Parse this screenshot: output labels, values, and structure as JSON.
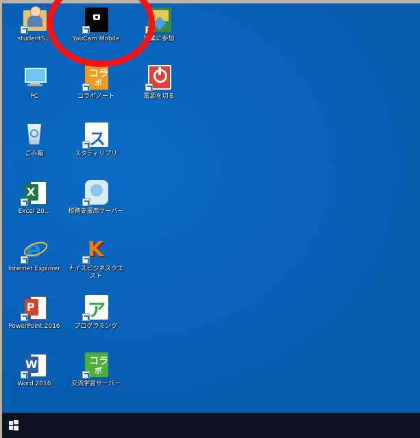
{
  "desktop": {
    "icons": [
      {
        "label": "studentS...",
        "icon": "user-folder-icon"
      },
      {
        "label": "YouCam Mobile",
        "icon": "camera-icon"
      },
      {
        "label": "授業に参加",
        "icon": "class-join-icon"
      },
      {
        "label": "PC",
        "icon": "computer-icon"
      },
      {
        "label": "コラボノート",
        "icon": "collabonote-icon"
      },
      {
        "label": "電源を切る",
        "icon": "power-icon"
      },
      {
        "label": "ごみ箱",
        "icon": "recycle-bin-icon"
      },
      {
        "label": "スタディリプリ",
        "icon": "studysapuri-icon"
      },
      {
        "label": "Excel 20...",
        "icon": "excel-icon"
      },
      {
        "label": "校務支援用サーバー",
        "icon": "server-icon"
      },
      {
        "label": "Internet Explorer",
        "icon": "internet-explorer-icon"
      },
      {
        "label": "ナイスビジネスクエスト",
        "icon": "k-app-icon"
      },
      {
        "label": "PowerPoint 2016",
        "icon": "powerpoint-icon"
      },
      {
        "label": "プログラミング",
        "icon": "programming-icon"
      },
      {
        "label": "Word 2016",
        "icon": "word-icon"
      },
      {
        "label": "交流学習サーバー",
        "icon": "exchange-server-icon"
      }
    ]
  },
  "colors": {
    "desktop": "#0863b8",
    "taskbar": "#0b1320",
    "annotation": "#ff1010"
  },
  "taskbar": {
    "start_icon": "windows-start-icon"
  }
}
